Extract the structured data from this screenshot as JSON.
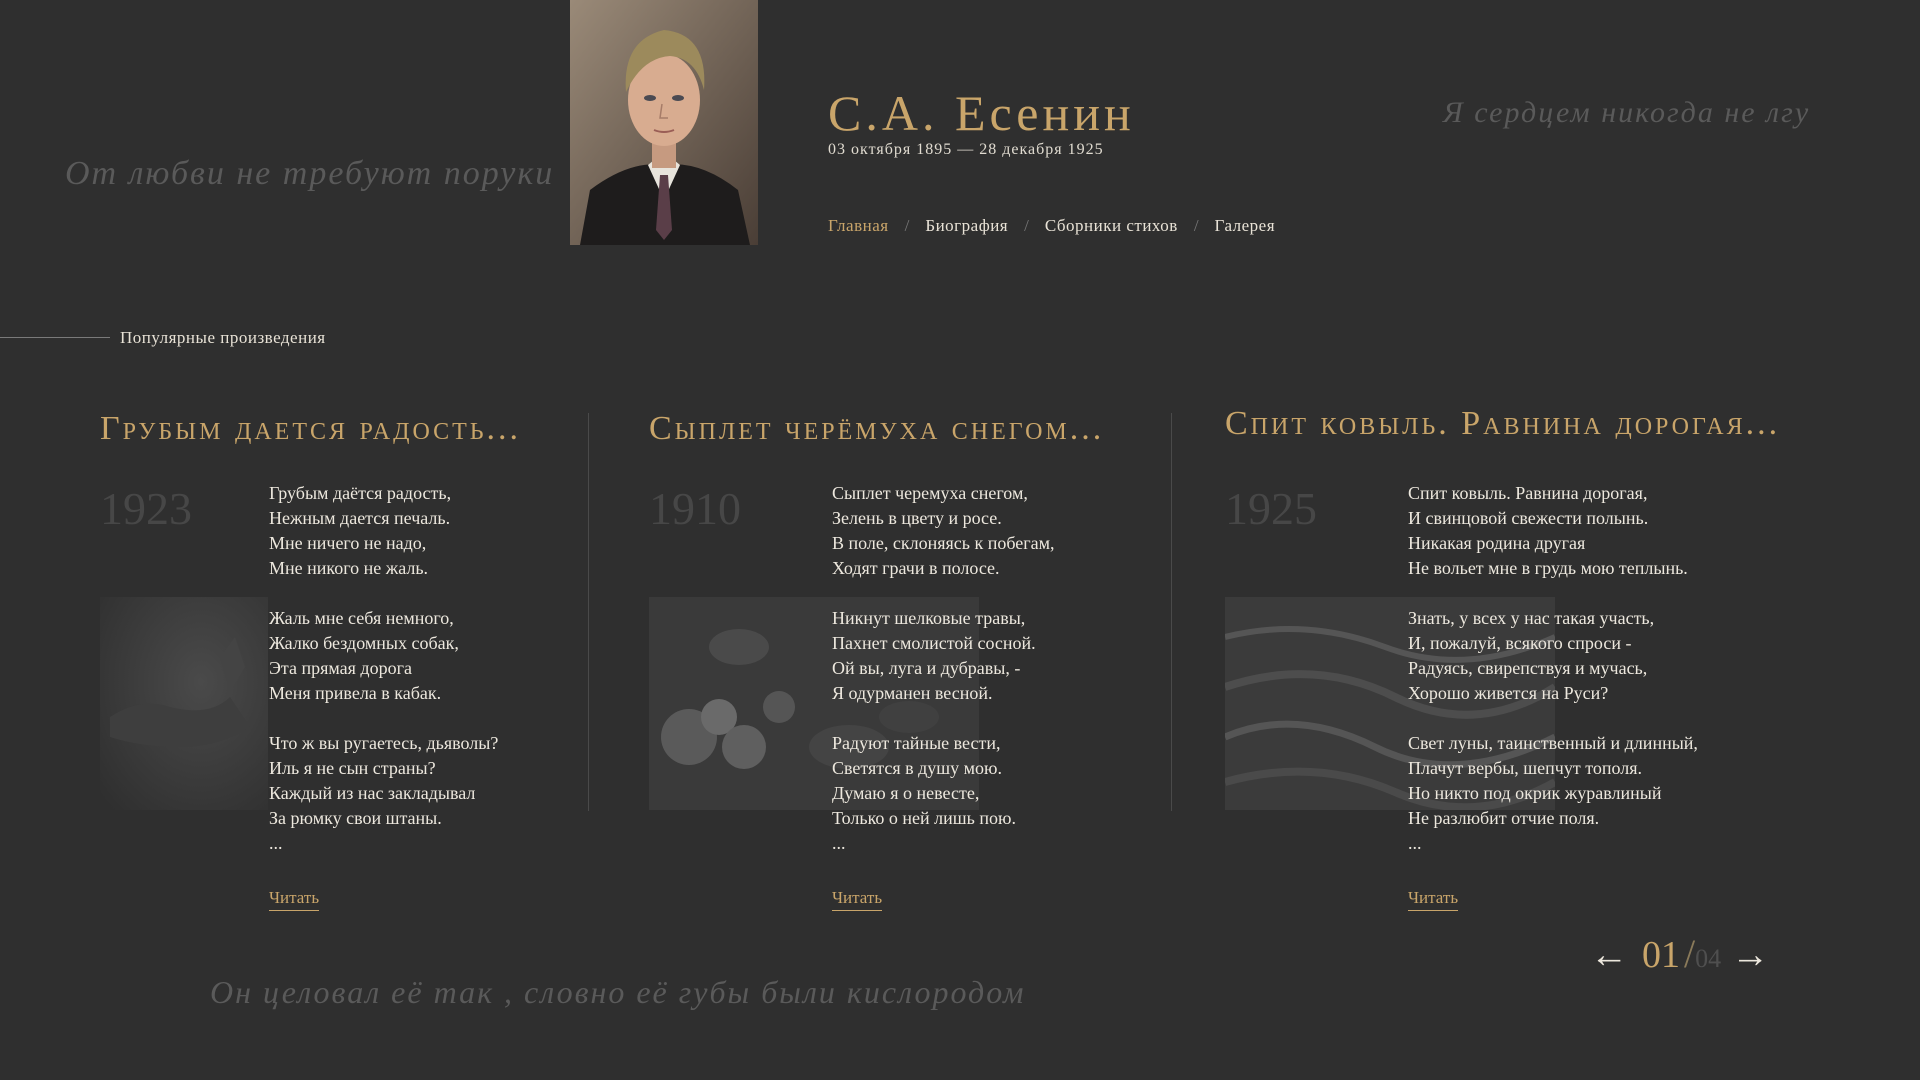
{
  "quotes": {
    "left": "От любви не требуют поруки",
    "right": "Я сердцем никогда не лгу",
    "bottom": "Он целовал её так , словно её губы были кислородом"
  },
  "header": {
    "title": "С.А. Есенин",
    "dates": "03 октября 1895 — 28 декабря 1925",
    "nav": [
      "Главная",
      "Биография",
      "Сборники стихов",
      "Галерея"
    ],
    "nav_separator": "/"
  },
  "section": {
    "label": "Популярные произведения"
  },
  "cards": [
    {
      "title": "Грубым дается радость...",
      "year": "1923",
      "stanzas": [
        [
          "Грубым даётся радость,",
          "Нежным дается печаль.",
          "Мне ничего не надо,",
          "Мне никого не жаль."
        ],
        [
          "Жаль мне себя немного,",
          "Жалко бездомных собак,",
          "Эта прямая дорога",
          "Меня привела в кабак."
        ],
        [
          "Что ж вы ругаетесь, дьяволы?",
          "Иль я не сын страны?",
          "Каждый из нас закладывал",
          "За рюмку свои штаны."
        ]
      ],
      "ellipsis": "...",
      "read_label": "Читать"
    },
    {
      "title": "Сыплет черёмуха снегом...",
      "year": "1910",
      "stanzas": [
        [
          "Сыплет черемуха снегом,",
          "Зелень в цвету и росе.",
          "В поле, склоняясь к побегам,",
          "Ходят грачи в полосе."
        ],
        [
          "Никнут шелковые травы,",
          "Пахнет смолистой сосной.",
          "Ой вы, луга и дубравы, -",
          "Я одурманен весной."
        ],
        [
          "Радуют тайные вести,",
          "Светятся в душу мою.",
          "Думаю я о невесте,",
          "Только о ней лишь пою."
        ]
      ],
      "ellipsis": "...",
      "read_label": "Читать"
    },
    {
      "title": "Спит ковыль. Равнина дорогая...",
      "year": "1925",
      "stanzas": [
        [
          "Спит ковыль. Равнина дорогая,",
          "И свинцовой свежести полынь.",
          "Никакая родина другая",
          "Не вольет мне в грудь мою теплынь."
        ],
        [
          "Знать, у всех у нас такая участь,",
          "И, пожалуй, всякого спроси -",
          "Радуясь, свирепствуя и мучась,",
          "Хорошо живется на Руси?"
        ],
        [
          "Свет луны, таинственный и длинный,",
          "Плачут вербы, шепчут тополя.",
          "Но никто под окрик журавлиный",
          "Не разлюбит отчие поля."
        ]
      ],
      "ellipsis": "...",
      "read_label": "Читать"
    }
  ],
  "pager": {
    "prev": "←",
    "current": "01",
    "slash": "/",
    "total": "04",
    "next": "→"
  },
  "colors": {
    "background": "#2f2f2f",
    "accent": "#c9a56a",
    "text": "#ede8de",
    "muted": "#5a5a5a"
  }
}
